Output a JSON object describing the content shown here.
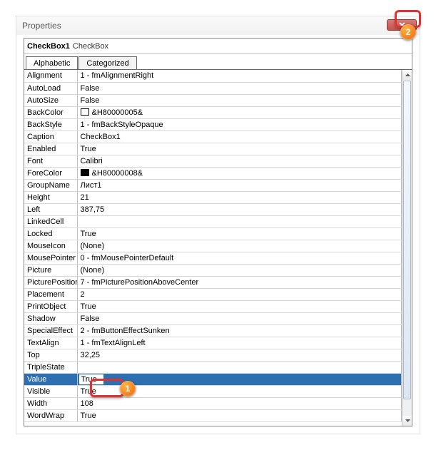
{
  "window": {
    "title": "Properties"
  },
  "object": {
    "name": "CheckBox1",
    "type": "CheckBox"
  },
  "tabs": {
    "alphabetic": "Alphabetic",
    "categorized": "Categorized",
    "active": 0
  },
  "colors": {
    "backcolor_swatch": "#ffffff",
    "forecolor_swatch": "#000000"
  },
  "rows": [
    {
      "name": "Alignment",
      "value": "1 - fmAlignmentRight"
    },
    {
      "name": "AutoLoad",
      "value": "False"
    },
    {
      "name": "AutoSize",
      "value": "False"
    },
    {
      "name": "BackColor",
      "value": "&H80000005&",
      "swatch": "backcolor_swatch"
    },
    {
      "name": "BackStyle",
      "value": "1 - fmBackStyleOpaque"
    },
    {
      "name": "Caption",
      "value": "CheckBox1"
    },
    {
      "name": "Enabled",
      "value": "True"
    },
    {
      "name": "Font",
      "value": "Calibri"
    },
    {
      "name": "ForeColor",
      "value": "&H80000008&",
      "swatch": "forecolor_swatch"
    },
    {
      "name": "GroupName",
      "value": "Лист1"
    },
    {
      "name": "Height",
      "value": "21"
    },
    {
      "name": "Left",
      "value": "387,75"
    },
    {
      "name": "LinkedCell",
      "value": ""
    },
    {
      "name": "Locked",
      "value": "True"
    },
    {
      "name": "MouseIcon",
      "value": "(None)"
    },
    {
      "name": "MousePointer",
      "value": "0 - fmMousePointerDefault"
    },
    {
      "name": "Picture",
      "value": "(None)"
    },
    {
      "name": "PicturePosition",
      "value": "7 - fmPicturePositionAboveCenter"
    },
    {
      "name": "Placement",
      "value": "2"
    },
    {
      "name": "PrintObject",
      "value": "True"
    },
    {
      "name": "Shadow",
      "value": "False"
    },
    {
      "name": "SpecialEffect",
      "value": "2 - fmButtonEffectSunken"
    },
    {
      "name": "TextAlign",
      "value": "1 - fmTextAlignLeft"
    },
    {
      "name": "Top",
      "value": "32,25"
    },
    {
      "name": "TripleState",
      "value": ""
    },
    {
      "name": "Value",
      "value": "True",
      "selected": true,
      "editing": true
    },
    {
      "name": "Visible",
      "value": "True"
    },
    {
      "name": "Width",
      "value": "108"
    },
    {
      "name": "WordWrap",
      "value": "True"
    }
  ],
  "annotations": {
    "badge1": "1",
    "badge2": "2"
  }
}
